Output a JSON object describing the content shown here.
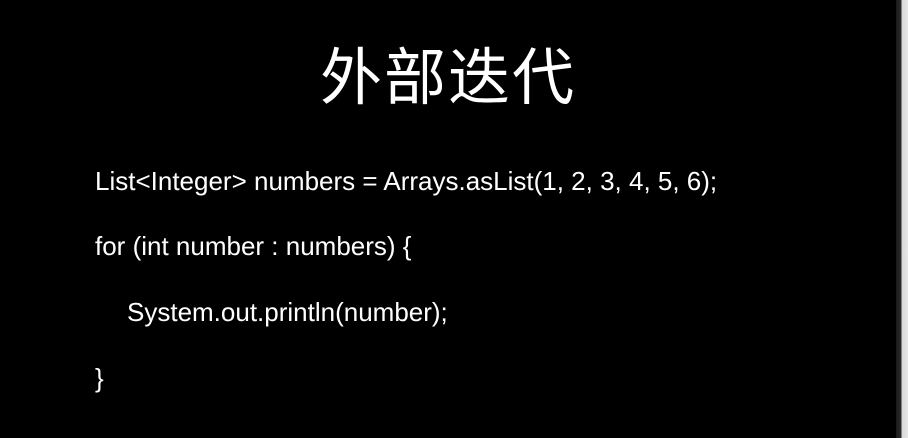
{
  "slide": {
    "title": "外部迭代",
    "code_lines": [
      "List<Integer> numbers = Arrays.asList(1, 2, 3, 4, 5, 6);",
      "for (int number : numbers) {",
      "System.out.println(number);",
      "}"
    ],
    "colors": {
      "background": "#000000",
      "text": "#ffffff"
    }
  }
}
